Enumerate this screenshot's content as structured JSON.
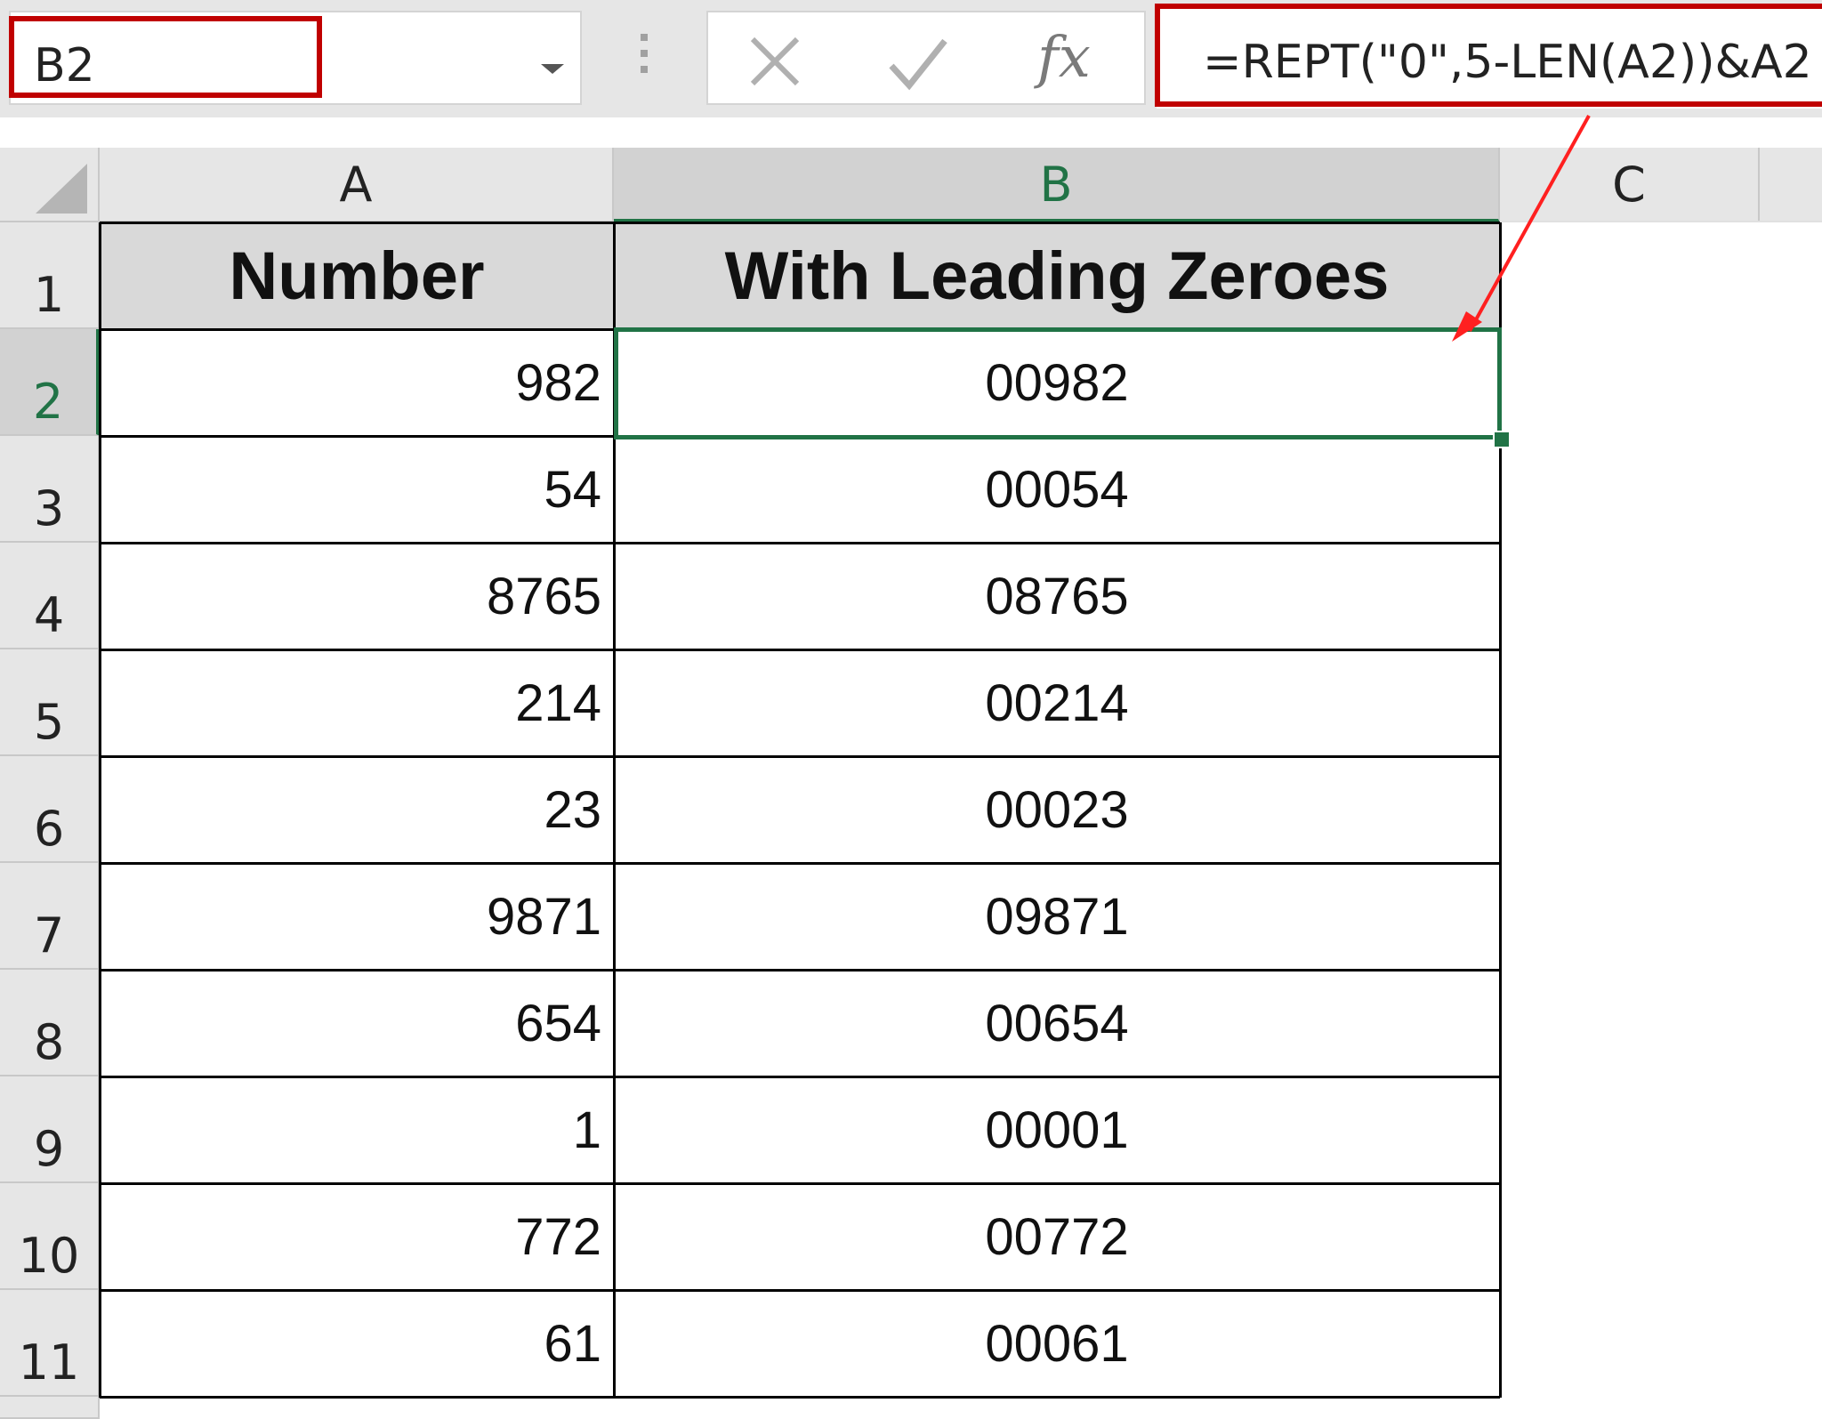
{
  "formula_bar": {
    "name_box": "B2",
    "formula": "=REPT(\"0\",5-LEN(A2))&A2",
    "fx_label": "fx"
  },
  "columns": [
    "A",
    "B",
    "C"
  ],
  "rows": [
    "1",
    "2",
    "3",
    "4",
    "5",
    "6",
    "7",
    "8",
    "9",
    "10",
    "11"
  ],
  "table": {
    "headers": [
      "Number",
      "With Leading Zeroes"
    ],
    "data": [
      [
        "982",
        "00982"
      ],
      [
        "54",
        "00054"
      ],
      [
        "8765",
        "08765"
      ],
      [
        "214",
        "00214"
      ],
      [
        "23",
        "00023"
      ],
      [
        "9871",
        "09871"
      ],
      [
        "654",
        "00654"
      ],
      [
        "1",
        "00001"
      ],
      [
        "772",
        "00772"
      ],
      [
        "61",
        "00061"
      ]
    ]
  },
  "colors": {
    "highlight": "#c00000",
    "selection": "#217346"
  }
}
